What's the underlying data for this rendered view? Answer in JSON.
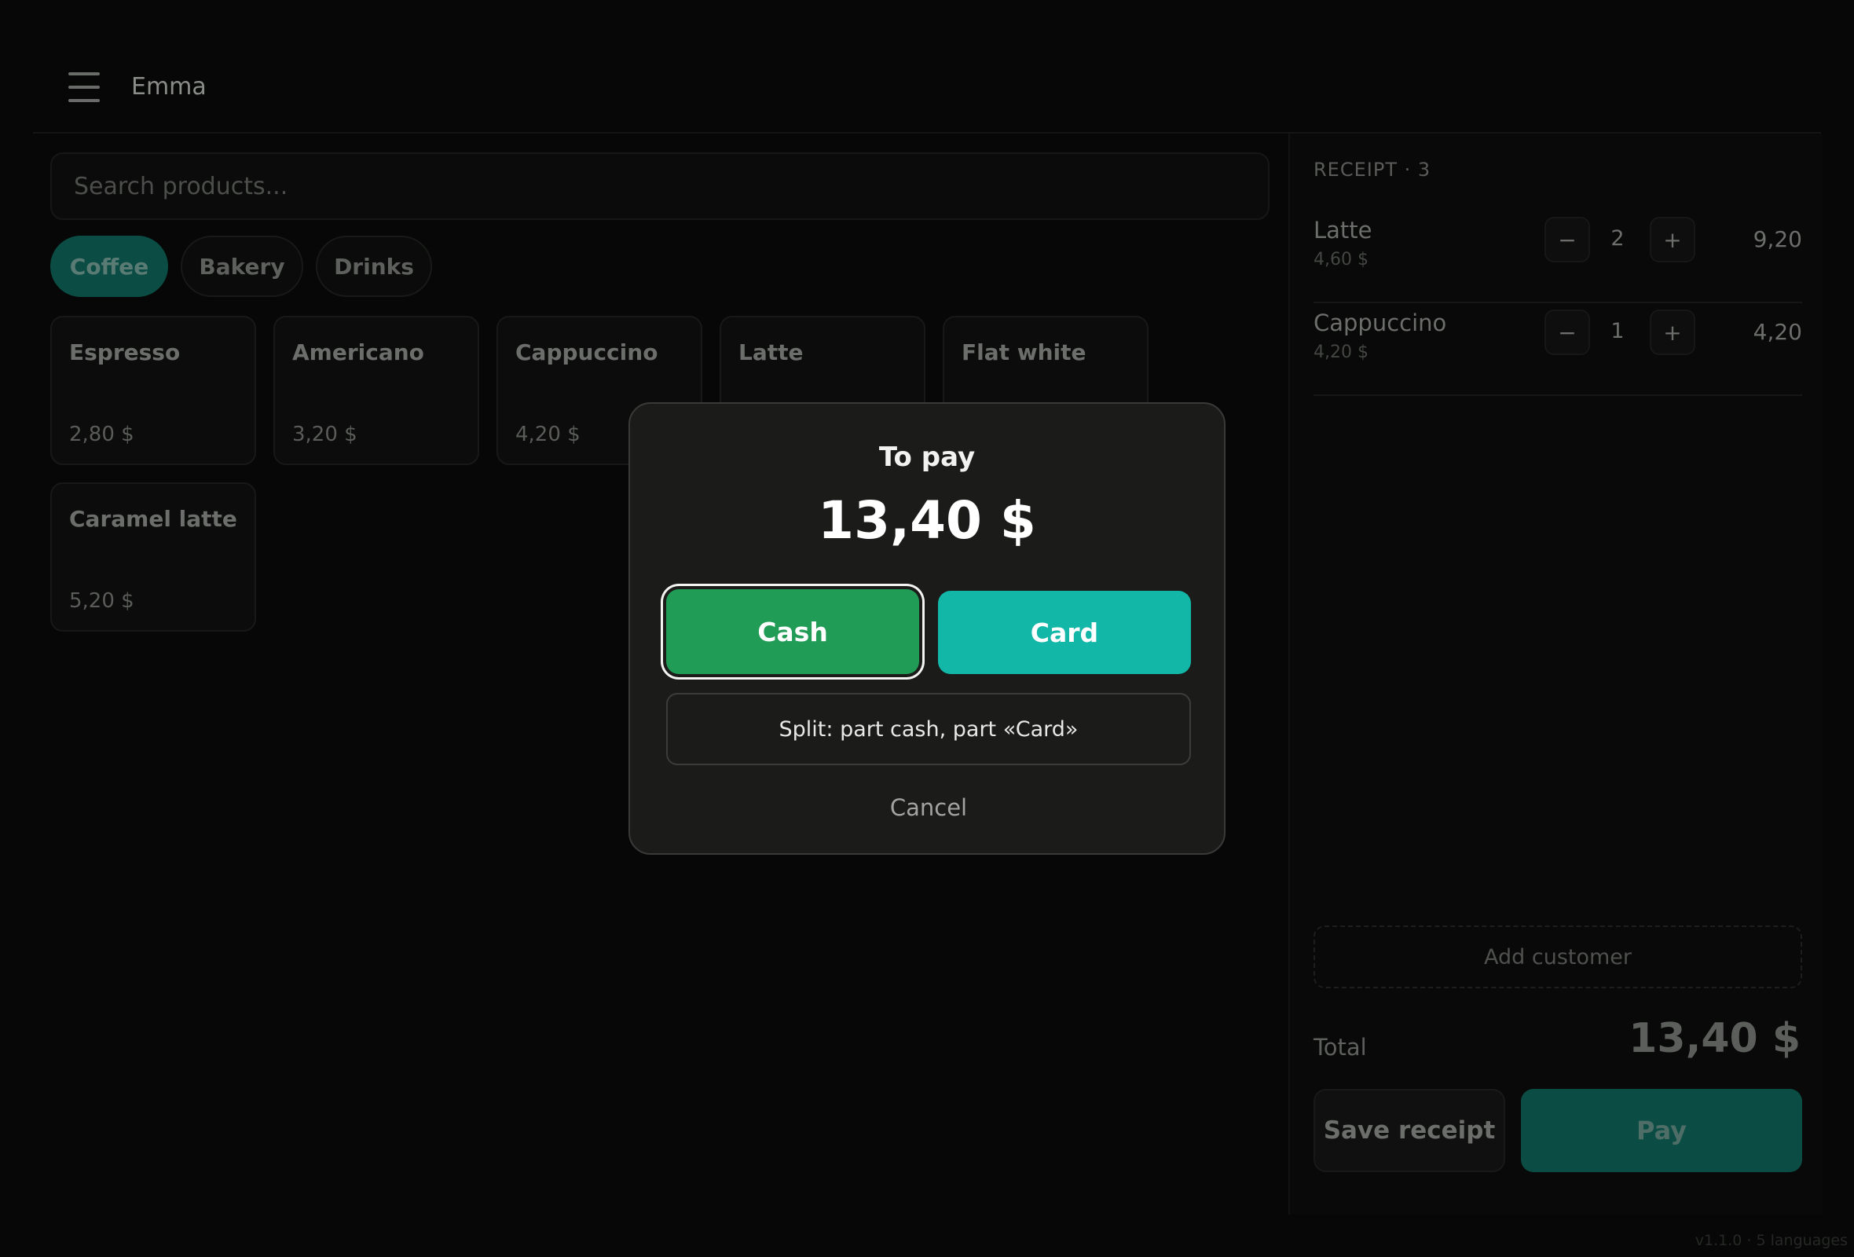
{
  "header": {
    "menu_icon": "hamburger-menu-icon",
    "user_name": "Emma"
  },
  "search": {
    "placeholder": "Search products..."
  },
  "categories": [
    {
      "label": "Coffee",
      "active": true
    },
    {
      "label": "Bakery",
      "active": false
    },
    {
      "label": "Drinks",
      "active": false
    }
  ],
  "products": [
    {
      "name": "Espresso",
      "price": "2,80 $"
    },
    {
      "name": "Americano",
      "price": "3,20 $"
    },
    {
      "name": "Cappuccino",
      "price": "4,20 $"
    },
    {
      "name": "Latte",
      "price": ""
    },
    {
      "name": "Flat white",
      "price": ""
    },
    {
      "name": "Caramel latte",
      "price": "5,20 $"
    }
  ],
  "receipt": {
    "title": "RECEIPT · 3",
    "items": [
      {
        "name": "Latte",
        "unit_price": "4,60 $",
        "qty": "2",
        "total": "9,20",
        "minus": "−",
        "plus": "+"
      },
      {
        "name": "Cappuccino",
        "unit_price": "4,20 $",
        "qty": "1",
        "total": "4,20",
        "minus": "−",
        "plus": "+"
      }
    ],
    "add_customer": "Add customer",
    "total_label": "Total",
    "total_value": "13,40 $",
    "save_label": "Save receipt",
    "pay_label": "Pay"
  },
  "footer": {
    "version": "v1.1.0 · 5 languages"
  },
  "modal": {
    "title": "To pay",
    "amount": "13,40 $",
    "cash_label": "Cash",
    "card_label": "Card",
    "split_label": "Split: part cash, part «Card»",
    "cancel_label": "Cancel"
  },
  "colors": {
    "accent_teal": "#13b7a8",
    "cash_green": "#219c56",
    "dim_teal": "#0b4d44"
  }
}
